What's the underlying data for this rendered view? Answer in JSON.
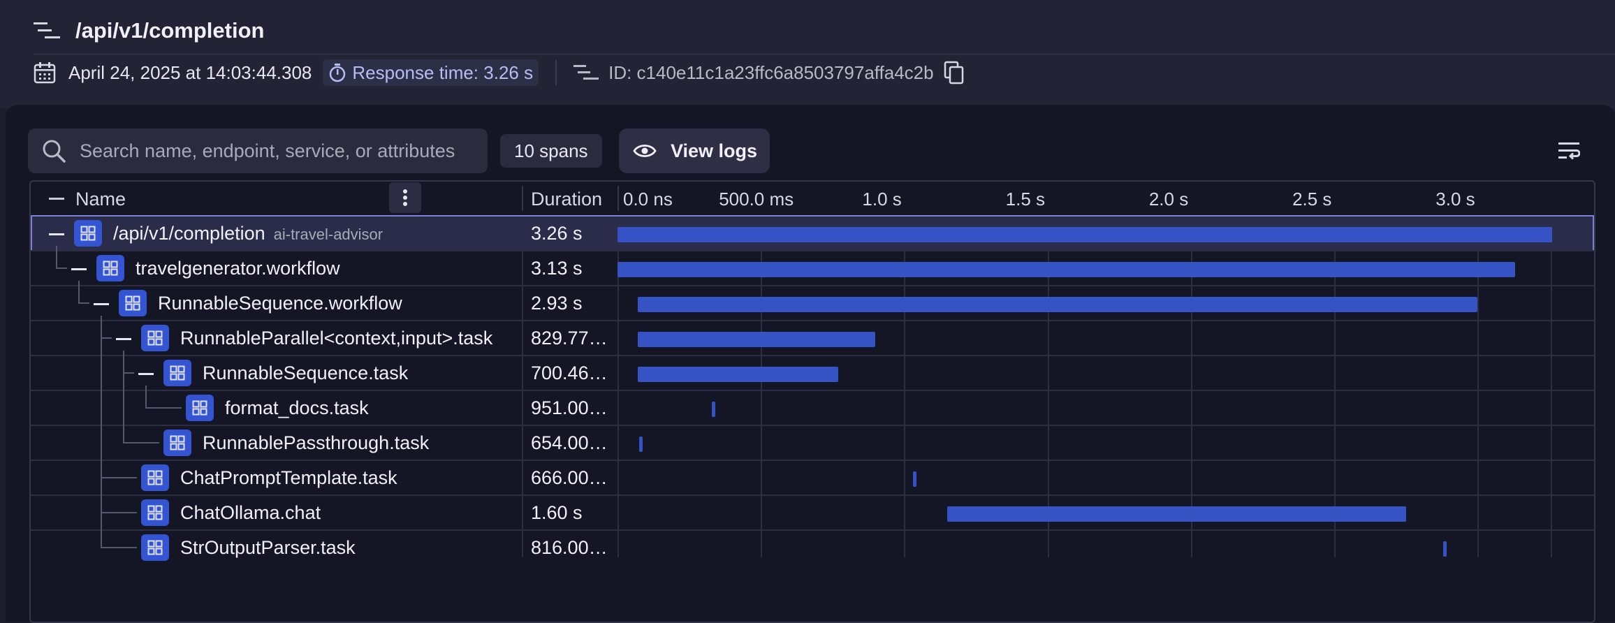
{
  "header": {
    "title": "/api/v1/completion",
    "date": "April 24, 2025 at 14:03:44.308",
    "response_time": "Response time: 3.26 s",
    "trace_id": "ID: c140e11c1a23ffc6a8503797affa4c2b"
  },
  "toolbar": {
    "search_placeholder": "Search name, endpoint, service, or attributes",
    "spans_count": "10 spans",
    "view_logs_label": "View logs"
  },
  "table": {
    "columns": {
      "name": "Name",
      "duration": "Duration"
    },
    "timeline_ticks": [
      "0.0 ns",
      "500.0 ms",
      "1.0 s",
      "1.5 s",
      "2.0 s",
      "2.5 s",
      "3.0 s"
    ],
    "timeline_max_s": 3.26,
    "spans": [
      {
        "name": "/api/v1/completion",
        "service": "ai-travel-advisor",
        "duration": "3.26 s",
        "start_s": 0.0,
        "length_s": 3.26,
        "depth": 0,
        "collapsible": true,
        "selected": true
      },
      {
        "name": "travelgenerator.workflow",
        "service": "",
        "duration": "3.13 s",
        "start_s": 0.0,
        "length_s": 3.13,
        "depth": 1,
        "collapsible": true,
        "selected": false
      },
      {
        "name": "RunnableSequence.workflow",
        "service": "",
        "duration": "2.93 s",
        "start_s": 0.07,
        "length_s": 2.93,
        "depth": 2,
        "collapsible": true,
        "selected": false
      },
      {
        "name": "RunnableParallel<context,input>.task",
        "service": "",
        "duration": "829.77…",
        "start_s": 0.07,
        "length_s": 0.83,
        "depth": 3,
        "collapsible": true,
        "selected": false
      },
      {
        "name": "RunnableSequence.task",
        "service": "",
        "duration": "700.46…",
        "start_s": 0.07,
        "length_s": 0.7,
        "depth": 4,
        "collapsible": true,
        "selected": false
      },
      {
        "name": "format_docs.task",
        "service": "",
        "duration": "951.00…",
        "start_s": 0.33,
        "length_s": 0.01,
        "depth": 5,
        "collapsible": false,
        "selected": false
      },
      {
        "name": "RunnablePassthrough.task",
        "service": "",
        "duration": "654.00…",
        "start_s": 0.075,
        "length_s": 0.01,
        "depth": 4,
        "collapsible": false,
        "selected": false
      },
      {
        "name": "ChatPromptTemplate.task",
        "service": "",
        "duration": "666.00…",
        "start_s": 1.03,
        "length_s": 0.01,
        "depth": 3,
        "collapsible": false,
        "selected": false
      },
      {
        "name": "ChatOllama.chat",
        "service": "",
        "duration": "1.60 s",
        "start_s": 1.15,
        "length_s": 1.6,
        "depth": 3,
        "collapsible": false,
        "selected": false
      },
      {
        "name": "StrOutputParser.task",
        "service": "",
        "duration": "816.00…",
        "start_s": 2.88,
        "length_s": 0.01,
        "depth": 3,
        "collapsible": false,
        "selected": false
      }
    ]
  },
  "colors": {
    "accent": "#3553c4",
    "icon_bg": "#3554d1",
    "pill_text": "#b8bcf4"
  }
}
